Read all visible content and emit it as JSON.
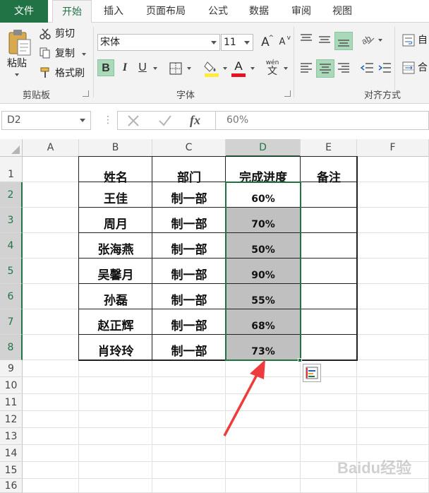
{
  "ribbon_tabs": {
    "file": "文件",
    "home": "开始",
    "insert": "插入",
    "page_layout": "页面布局",
    "formulas": "公式",
    "data": "数据",
    "review": "审阅",
    "view": "视图"
  },
  "clipboard": {
    "paste": "粘贴",
    "cut": "剪切",
    "copy": "复制",
    "format_painter": "格式刷",
    "group_label": "剪贴板"
  },
  "font": {
    "name": "宋体",
    "size": "11",
    "bold": "B",
    "italic": "I",
    "underline": "U",
    "phonetic": "wén",
    "phonetic_sub": "文",
    "grow": "A",
    "shrink": "A",
    "font_color_letter": "A",
    "group_label": "字体",
    "font_color": "#e81123",
    "fill_color": "#ffeb3b"
  },
  "alignment": {
    "group_label": "对齐方式",
    "wrap_char": "自",
    "merge_char": "合"
  },
  "formula_bar": {
    "name_box": "D2",
    "fx": "fx",
    "content": "60%"
  },
  "sheet": {
    "columns": [
      "A",
      "B",
      "C",
      "D",
      "E",
      "F"
    ],
    "selected_column": "D",
    "rows": [
      "1",
      "2",
      "3",
      "4",
      "5",
      "6",
      "7",
      "8",
      "9",
      "10",
      "11",
      "12",
      "13",
      "14",
      "15",
      "16"
    ],
    "headers": {
      "name": "姓名",
      "dept": "部门",
      "progress": "完成进度",
      "note": "备注"
    },
    "records": [
      {
        "name": "王佳",
        "dept": "制一部",
        "progress": "60%"
      },
      {
        "name": "周月",
        "dept": "制一部",
        "progress": "70%"
      },
      {
        "name": "张海燕",
        "dept": "制一部",
        "progress": "50%"
      },
      {
        "name": "吴馨月",
        "dept": "制一部",
        "progress": "90%"
      },
      {
        "name": "孙磊",
        "dept": "制一部",
        "progress": "55%"
      },
      {
        "name": "赵正辉",
        "dept": "制一部",
        "progress": "68%"
      },
      {
        "name": "肖玲玲",
        "dept": "制一部",
        "progress": "73%"
      }
    ]
  },
  "colors": {
    "accent": "#217346",
    "selection_shade": "#c0c0c0",
    "annotation_arrow": "#ee3b3b"
  },
  "watermark": "Baidu经验"
}
